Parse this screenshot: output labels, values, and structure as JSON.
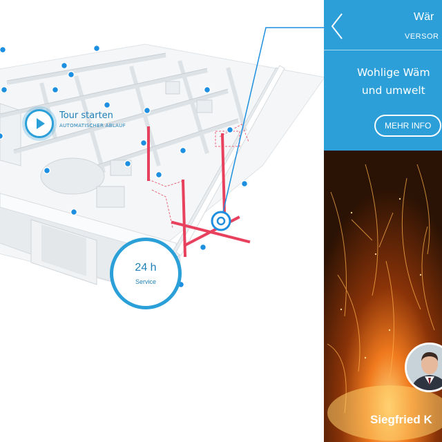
{
  "tour": {
    "title": "Tour starten",
    "subtitle": "AUTOMATISCHER ABLAUF",
    "icon": "play-icon"
  },
  "service": {
    "hours": "24 h",
    "label": "Service"
  },
  "panel": {
    "title": "Wär",
    "category": "VERSOR",
    "headline_line1": "Wohlige Wäm",
    "headline_line2": "und umwelt",
    "more_button": "MEHR INFO",
    "contact_name": "Siegfried K",
    "back_icon": "chevron-left-icon",
    "image": "sparks-fire-image",
    "avatar": "contact-avatar"
  },
  "colors": {
    "accent": "#2c9fd9",
    "pipe": "#e8415e",
    "marker": "#1d8fe0"
  }
}
